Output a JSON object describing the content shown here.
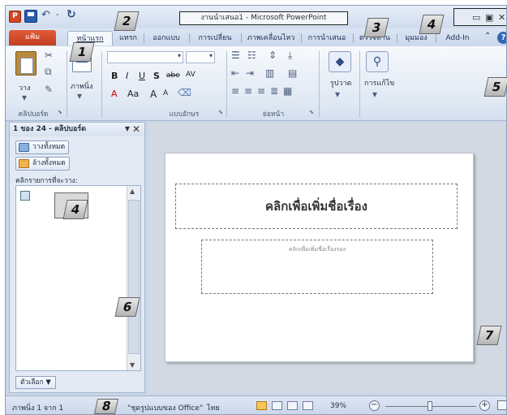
{
  "titlebar": {
    "app_icon": "P",
    "doc_title": "งานนำเสนอ1 - Microsoft PowerPoint",
    "qat": {
      "save": "save-icon",
      "undo": "↶",
      "separator": "-",
      "redo": "↻"
    },
    "window_controls": {
      "minimize": "▭",
      "restore": "▣",
      "close": "✕"
    }
  },
  "tabs": {
    "file": "แฟ้ม",
    "items": [
      "หน้าแรก",
      "แทรก",
      "ออกแบบ",
      "การเปลี่ยน",
      "ภาพเคลื่อนไหว",
      "การนำเสนอ",
      "ตรวจทาน",
      "มุมมอง",
      "Add-In"
    ],
    "active": "หน้าแรก",
    "help": "?"
  },
  "ribbon": {
    "clipboard": {
      "label": "คลิปบอร์ด",
      "paste": "วาง"
    },
    "slides": {
      "new_slide": "ภาพนิ่ง"
    },
    "font": {
      "label": "แบบอักษร",
      "bold": "B",
      "italic": "I",
      "underline": "U",
      "shadow": "S",
      "strike": "abe",
      "spacing": "AV",
      "color": "A",
      "case": "Aa",
      "grow": "A",
      "shrink": "A"
    },
    "paragraph": {
      "label": "ย่อหน้า"
    },
    "drawing": {
      "label": "รูปวาด"
    },
    "editing": {
      "label": "การแก้ไข"
    }
  },
  "pane": {
    "header": "1 ของ 24 - คลิปบอร์ด",
    "menu": "▼",
    "close": "✕",
    "paste_all": "วางทั้งหมด",
    "clear_all": "ล้างทั้งหมด",
    "caption": "คลิกรายการที่จะวาง:",
    "options": "ตัวเลือก ▼"
  },
  "slide": {
    "title_placeholder": "คลิกเพื่อเพิ่มชื่อเรื่อง",
    "subtitle_placeholder": "คลิกเพื่อเพิ่มชื่อเรื่องรอง"
  },
  "status": {
    "slide_info": "ภาพนิ่ง 1 จาก 1",
    "theme": "\"ชุดรูปแบบของ Office\"",
    "language": "ไทย",
    "zoom": "39%",
    "zoom_out": "−",
    "zoom_in": "+"
  },
  "callouts": [
    "1",
    "2",
    "3",
    "4",
    "4",
    "5",
    "6",
    "7",
    "8"
  ]
}
